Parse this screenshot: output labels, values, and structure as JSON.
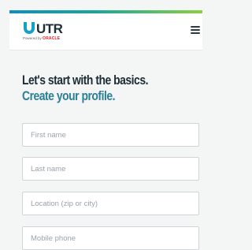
{
  "header": {
    "logo_text": "UTR",
    "powered_by": "Powered by",
    "powered_brand": "ORACLE",
    "menu_icon": "hamburger-menu-icon",
    "stripe_colors": [
      "#0f8fbf",
      "#17a79a",
      "#8dcf3f"
    ]
  },
  "main": {
    "heading": "Let's start with the basics.",
    "subheading": "Create your profile.",
    "fields": {
      "first_name": {
        "placeholder": "First name",
        "value": ""
      },
      "last_name": {
        "placeholder": "Last name",
        "value": ""
      },
      "location": {
        "placeholder": "Location (zip or city)",
        "value": ""
      },
      "mobile_phone": {
        "placeholder": "Mobile phone",
        "value": ""
      }
    }
  },
  "colors": {
    "heading": "#1c2d35",
    "subheading": "#2b7f98",
    "logo_mark": "#14a1c4",
    "oracle_red": "#e0232a"
  }
}
